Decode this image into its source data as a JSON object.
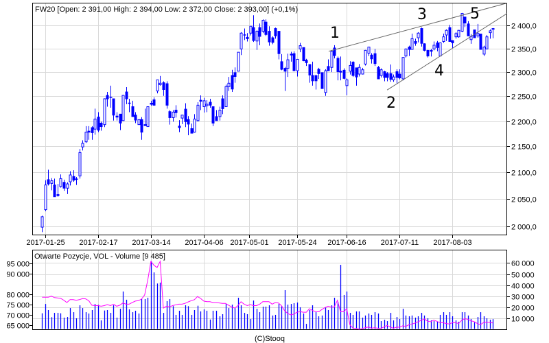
{
  "chart_data": [
    {
      "type": "candlestick",
      "title": "FW20 [Open: 2 391,00  High: 2 394,00  Low: 2 372,00  Close: 2 393,00] (+0,1%)",
      "y_scale": "log",
      "ylim": [
        1985,
        2450
      ],
      "y_ticks": [
        2000,
        2050,
        2100,
        2150,
        2200,
        2250,
        2300,
        2350,
        2400
      ],
      "y_tick_labels": [
        "2 000,0",
        "2 050,0",
        "2 100,0",
        "2 150,0",
        "2 200,0",
        "2 250,0",
        "2 300,0",
        "2 350,0",
        "2 400,0"
      ],
      "x_ticks": [
        {
          "index": 1,
          "label": "2017-01-25"
        },
        {
          "index": 18,
          "label": "2017-02-17"
        },
        {
          "index": 35,
          "label": "2017-03-14"
        },
        {
          "index": 52,
          "label": "2017-04-06"
        },
        {
          "index": 66.6,
          "label": "2017-05-01"
        },
        {
          "index": 82,
          "label": "2017-05-24"
        },
        {
          "index": 98,
          "label": "2017-06-16"
        },
        {
          "index": 115,
          "label": "2017-07-11"
        },
        {
          "index": 132,
          "label": "2017-08-03"
        }
      ],
      "grid": true,
      "ohlc_fields": [
        "open",
        "high",
        "low",
        "close"
      ],
      "ohlc": [
        [
          1998,
          2019,
          1989,
          2017
        ],
        [
          2030,
          2085,
          2027,
          2076
        ],
        [
          2086,
          2105,
          2075,
          2078
        ],
        [
          2079,
          2089,
          2066,
          2084
        ],
        [
          2076,
          2088,
          2054,
          2054
        ],
        [
          2058,
          2078,
          2054,
          2056
        ],
        [
          2073,
          2096,
          2071,
          2088
        ],
        [
          2081,
          2086,
          2065,
          2070
        ],
        [
          2070,
          2081,
          2059,
          2078
        ],
        [
          2082,
          2102,
          2075,
          2095
        ],
        [
          2092,
          2104,
          2082,
          2085
        ],
        [
          2087,
          2091,
          2076,
          2087
        ],
        [
          2093,
          2145,
          2088,
          2138
        ],
        [
          2149,
          2162,
          2142,
          2156
        ],
        [
          2159,
          2190,
          2157,
          2178
        ],
        [
          2180,
          2190,
          2163,
          2178
        ],
        [
          2187,
          2190,
          2163,
          2177
        ],
        [
          2184,
          2225,
          2173,
          2204
        ],
        [
          2208,
          2218,
          2178,
          2182
        ],
        [
          2196,
          2199,
          2181,
          2189
        ],
        [
          2193,
          2246,
          2188,
          2245
        ],
        [
          2252,
          2259,
          2229,
          2245
        ],
        [
          2248,
          2272,
          2227,
          2248
        ],
        [
          2245,
          2245,
          2201,
          2212
        ],
        [
          2210,
          2218,
          2201,
          2208
        ],
        [
          2214,
          2214,
          2182,
          2196
        ],
        [
          2201,
          2253,
          2200,
          2252
        ],
        [
          2259,
          2269,
          2234,
          2245
        ],
        [
          2236,
          2245,
          2218,
          2236
        ],
        [
          2229,
          2241,
          2209,
          2209
        ],
        [
          2212,
          2218,
          2196,
          2202
        ],
        [
          2193,
          2203,
          2193,
          2203
        ],
        [
          2203,
          2208,
          2163,
          2178
        ],
        [
          2193,
          2225,
          2191,
          2191
        ],
        [
          2189,
          2229,
          2189,
          2229
        ],
        [
          2236,
          2241,
          2231,
          2234
        ],
        [
          2243,
          2248,
          2231,
          2232
        ],
        [
          2261,
          2284,
          2256,
          2284
        ],
        [
          2274,
          2292,
          2272,
          2277
        ],
        [
          2278,
          2281,
          2251,
          2264
        ],
        [
          2276,
          2281,
          2225,
          2232
        ],
        [
          2219,
          2222,
          2193,
          2207
        ],
        [
          2207,
          2222,
          2199,
          2218
        ],
        [
          2222,
          2232,
          2207,
          2217
        ],
        [
          2190,
          2202,
          2178,
          2187
        ],
        [
          2206,
          2212,
          2194,
          2212
        ],
        [
          2224,
          2236,
          2188,
          2199
        ],
        [
          2203,
          2210,
          2172,
          2194
        ],
        [
          2185,
          2195,
          2176,
          2176
        ],
        [
          2178,
          2214,
          2177,
          2204
        ],
        [
          2201,
          2238,
          2199,
          2232
        ],
        [
          2242,
          2252,
          2222,
          2240
        ],
        [
          2229,
          2247,
          2217,
          2241
        ],
        [
          2231,
          2242,
          2218,
          2234
        ],
        [
          2238,
          2245,
          2227,
          2232
        ],
        [
          2229,
          2229,
          2190,
          2196
        ],
        [
          2209,
          2222,
          2201,
          2201
        ],
        [
          2209,
          2229,
          2201,
          2222
        ],
        [
          2245,
          2252,
          2214,
          2225
        ],
        [
          2229,
          2274,
          2229,
          2270
        ],
        [
          2270,
          2290,
          2261,
          2277
        ],
        [
          2293,
          2305,
          2259,
          2265
        ],
        [
          2299,
          2310,
          2278,
          2291
        ],
        [
          2302,
          2342,
          2302,
          2342
        ],
        [
          2349,
          2385,
          2336,
          2383
        ],
        [
          2379,
          2393,
          2368,
          2379
        ],
        [
          2374,
          2383,
          2365,
          2371
        ],
        [
          2383,
          2398,
          2378,
          2398
        ],
        [
          2395,
          2422,
          2364,
          2367
        ],
        [
          2366,
          2389,
          2347,
          2387
        ],
        [
          2395,
          2404,
          2357,
          2376
        ],
        [
          2387,
          2413,
          2383,
          2411
        ],
        [
          2407,
          2413,
          2377,
          2380
        ],
        [
          2387,
          2398,
          2356,
          2364
        ],
        [
          2373,
          2376,
          2359,
          2363
        ],
        [
          2393,
          2395,
          2371,
          2377
        ],
        [
          2387,
          2387,
          2327,
          2339
        ],
        [
          2322,
          2338,
          2304,
          2306
        ],
        [
          2308,
          2311,
          2261,
          2302
        ],
        [
          2308,
          2339,
          2290,
          2326
        ],
        [
          2338,
          2343,
          2322,
          2336
        ],
        [
          2339,
          2344,
          2303,
          2303
        ],
        [
          2303,
          2327,
          2291,
          2327
        ],
        [
          2349,
          2362,
          2342,
          2356
        ],
        [
          2352,
          2352,
          2323,
          2324
        ],
        [
          2325,
          2328,
          2313,
          2320
        ],
        [
          2316,
          2316,
          2278,
          2294
        ],
        [
          2293,
          2322,
          2272,
          2282
        ],
        [
          2293,
          2293,
          2264,
          2282
        ],
        [
          2306,
          2309,
          2286,
          2297
        ],
        [
          2299,
          2299,
          2266,
          2266
        ],
        [
          2258,
          2306,
          2251,
          2303
        ],
        [
          2312,
          2327,
          2303,
          2303
        ],
        [
          2310,
          2346,
          2300,
          2344
        ],
        [
          2351,
          2357,
          2329,
          2335
        ],
        [
          2329,
          2333,
          2283,
          2301
        ],
        [
          2302,
          2333,
          2283,
          2300
        ],
        [
          2304,
          2308,
          2285,
          2287
        ],
        [
          2272,
          2287,
          2252,
          2284
        ],
        [
          2302,
          2323,
          2295,
          2314
        ],
        [
          2321,
          2323,
          2290,
          2293
        ],
        [
          2309,
          2309,
          2272,
          2290
        ],
        [
          2296,
          2317,
          2291,
          2310
        ],
        [
          2296,
          2309,
          2295,
          2305
        ],
        [
          2317,
          2347,
          2314,
          2346
        ],
        [
          2340,
          2353,
          2334,
          2353
        ],
        [
          2336,
          2340,
          2318,
          2328
        ],
        [
          2339,
          2349,
          2313,
          2318
        ],
        [
          2310,
          2313,
          2286,
          2286
        ],
        [
          2293,
          2308,
          2289,
          2305
        ],
        [
          2301,
          2303,
          2281,
          2289
        ],
        [
          2297,
          2300,
          2281,
          2289
        ],
        [
          2297,
          2316,
          2280,
          2285
        ],
        [
          2284,
          2295,
          2280,
          2290
        ],
        [
          2301,
          2306,
          2277,
          2289
        ],
        [
          2296,
          2306,
          2285,
          2288
        ],
        [
          2286,
          2332,
          2283,
          2331
        ],
        [
          2334,
          2350,
          2331,
          2349
        ],
        [
          2353,
          2356,
          2334,
          2348
        ],
        [
          2348,
          2382,
          2348,
          2371
        ],
        [
          2365,
          2371,
          2356,
          2361
        ],
        [
          2373,
          2385,
          2363,
          2383
        ],
        [
          2393,
          2395,
          2354,
          2361
        ],
        [
          2360,
          2361,
          2344,
          2346
        ],
        [
          2346,
          2347,
          2331,
          2334
        ],
        [
          2346,
          2349,
          2333,
          2344
        ],
        [
          2349,
          2365,
          2346,
          2357
        ],
        [
          2362,
          2366,
          2344,
          2352
        ],
        [
          2334,
          2363,
          2334,
          2362
        ],
        [
          2365,
          2382,
          2362,
          2375
        ],
        [
          2379,
          2391,
          2366,
          2389
        ],
        [
          2395,
          2401,
          2365,
          2365
        ],
        [
          2367,
          2367,
          2351,
          2362
        ],
        [
          2375,
          2385,
          2371,
          2382
        ],
        [
          2375,
          2390,
          2373,
          2389
        ],
        [
          2387,
          2427,
          2385,
          2426
        ],
        [
          2418,
          2419,
          2396,
          2405
        ],
        [
          2403,
          2409,
          2377,
          2377
        ],
        [
          2369,
          2381,
          2360,
          2376
        ],
        [
          2390,
          2390,
          2373,
          2373
        ],
        [
          2377,
          2403,
          2373,
          2382
        ],
        [
          2381,
          2381,
          2348,
          2348
        ],
        [
          2338,
          2356,
          2334,
          2353
        ],
        [
          2349,
          2379,
          2348,
          2375
        ],
        [
          2384,
          2391,
          2371,
          2388
        ],
        [
          2391,
          2394,
          2372,
          2393
        ]
      ],
      "trendlines": [
        {
          "name": "upper-trendline",
          "points": [
            [
              92.2,
              2344
            ],
            [
              149.6,
              2449
            ]
          ]
        },
        {
          "name": "lower-trendline",
          "points": [
            [
              111.0,
              2263
            ],
            [
              149.6,
              2426
            ]
          ]
        }
      ],
      "wave_labels": [
        "1",
        "2",
        "3",
        "4",
        "5"
      ],
      "colors": {
        "candle": "#0000ff",
        "grid": "#d9d9d9",
        "trendline": "#666666"
      }
    },
    {
      "type": "bar+line",
      "title": "Otwarte Pozycje, VOL - Volume [9 485]",
      "left_axis": {
        "label": "Otwarte Pozycje",
        "ticks": [
          65000,
          70000,
          75000,
          80000,
          90000,
          95000
        ],
        "tick_labels": [
          "65 000",
          "70 000",
          "75 000",
          "80 000",
          "90 000",
          "95 000"
        ]
      },
      "right_axis": {
        "label": "Volume",
        "ylim": [
          0,
          62000
        ],
        "ticks": [
          10000,
          20000,
          30000,
          40000,
          50000,
          60000
        ],
        "tick_labels": [
          "10 000",
          "20 000",
          "30 000",
          "40 000",
          "50 000",
          "60 000"
        ]
      },
      "volume": [
        14700,
        23100,
        17600,
        11200,
        15100,
        15100,
        14700,
        10800,
        11400,
        19400,
        15700,
        10200,
        21900,
        19400,
        15700,
        14500,
        17600,
        23100,
        22300,
        8300,
        17200,
        17600,
        15100,
        21900,
        10800,
        18800,
        34300,
        26900,
        18200,
        15700,
        17000,
        14500,
        27500,
        27500,
        28700,
        61600,
        51500,
        41500,
        42300,
        15100,
        25600,
        27500,
        21100,
        13300,
        17000,
        13300,
        21900,
        21100,
        13300,
        17600,
        21500,
        16400,
        18200,
        17000,
        9100,
        17000,
        17000,
        12000,
        13900,
        23300,
        19400,
        22500,
        19400,
        28700,
        21900,
        15100,
        13900,
        9600,
        26200,
        18800,
        15700,
        20700,
        20700,
        21900,
        12700,
        13300,
        23100,
        21300,
        35500,
        22500,
        23100,
        23800,
        24400,
        20100,
        14500,
        5200,
        17600,
        21900,
        15700,
        12000,
        12700,
        20100,
        17600,
        21900,
        28700,
        25000,
        58300,
        31200,
        34300,
        15100,
        13300,
        16400,
        16400,
        10800,
        12700,
        14500,
        13300,
        15700,
        14500,
        7700,
        8900,
        7700,
        15100,
        8300,
        11400,
        9600,
        18800,
        12700,
        12000,
        12700,
        10800,
        12000,
        15100,
        12700,
        10200,
        8300,
        7700,
        7100,
        13300,
        15700,
        13300,
        15700,
        12000,
        8300,
        7100,
        15700,
        15700,
        12700,
        9600,
        6500,
        11400,
        15700,
        12000,
        10200,
        8900,
        9485
      ],
      "open_interest": [
        78500,
        78500,
        78500,
        79000,
        78300,
        78100,
        77900,
        77000,
        75900,
        77300,
        77300,
        77000,
        77300,
        77800,
        77700,
        76800,
        74600,
        74400,
        74400,
        74100,
        74400,
        74900,
        74400,
        75100,
        74100,
        74600,
        75700,
        75100,
        75100,
        75900,
        76600,
        76800,
        77600,
        79600,
        86800,
        95900,
        94000,
        92900,
        95900,
        73200,
        74100,
        73800,
        74400,
        74800,
        75100,
        75100,
        75500,
        76200,
        76800,
        77300,
        78800,
        77900,
        76600,
        76300,
        76300,
        75900,
        75900,
        75700,
        75500,
        75500,
        74600,
        73700,
        73200,
        74400,
        76300,
        75100,
        74400,
        74900,
        74400,
        74400,
        75100,
        76300,
        76300,
        76300,
        75100,
        75900,
        75700,
        74400,
        72000,
        70600,
        69900,
        70300,
        71200,
        71500,
        71200,
        71200,
        72900,
        72000,
        71500,
        71400,
        72500,
        73400,
        74100,
        73700,
        73700,
        77000,
        71400,
        71400,
        72900,
        65100,
        63500,
        63300,
        62900,
        63200,
        63700,
        64000,
        63400,
        63700,
        63400,
        63400,
        64000,
        64800,
        64000,
        63400,
        63900,
        63900,
        64600,
        64300,
        65100,
        65500,
        65900,
        66600,
        67300,
        67900,
        66800,
        66600,
        67300,
        66800,
        66100,
        66100,
        65700,
        65500,
        66100,
        66100,
        65700,
        67300,
        68100,
        67700,
        67000,
        66600,
        65700,
        65100,
        66200,
        66300,
        66200,
        66000
      ],
      "colors": {
        "volume": "#0000ff",
        "open_interest": "#ff00ff"
      }
    }
  ],
  "footer": "(C)Stooq"
}
